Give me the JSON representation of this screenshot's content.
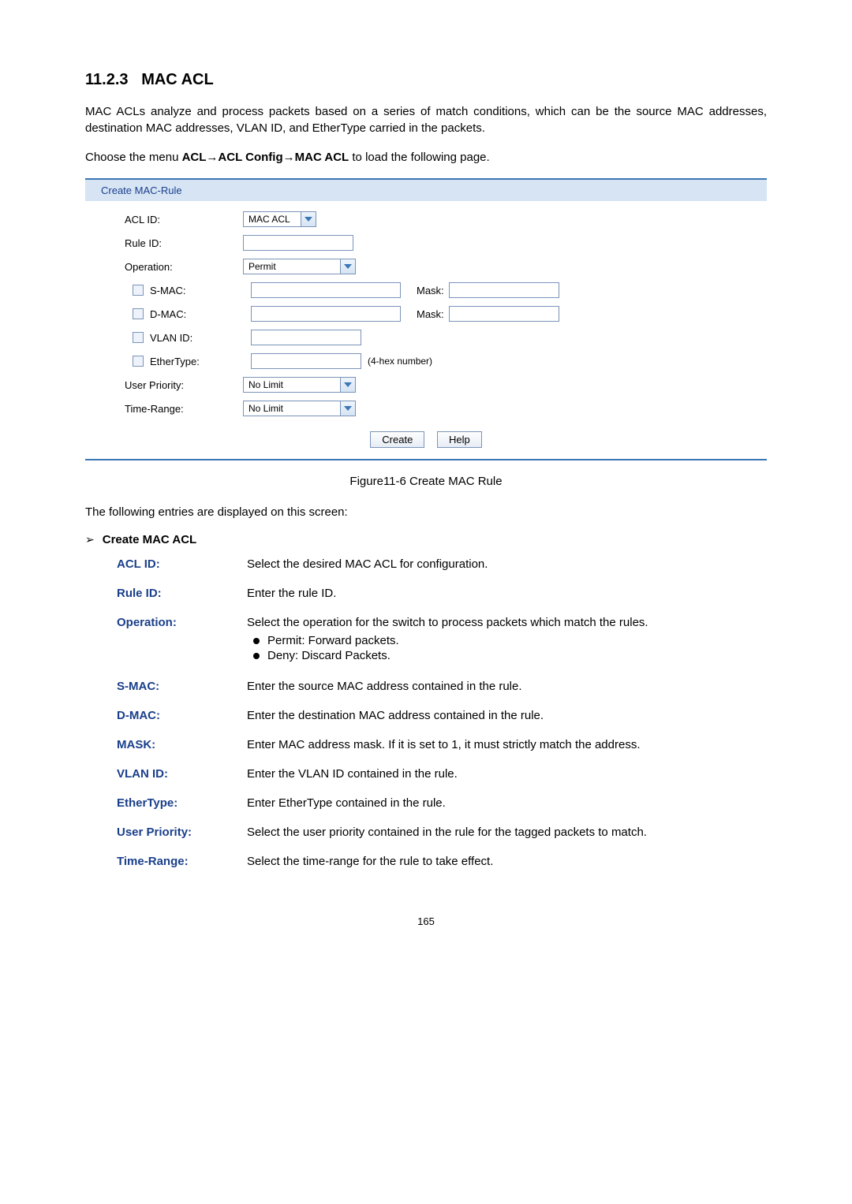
{
  "section": {
    "number": "11.2.3",
    "title": "MAC ACL",
    "intro": "MAC ACLs analyze and process packets based on a series of match conditions, which can be the source MAC addresses, destination MAC addresses, VLAN ID, and EtherType carried in the packets.",
    "menu_prefix": "Choose the menu ",
    "menu_path": "ACL→ACL Config→MAC ACL",
    "menu_suffix": " to load the following page."
  },
  "panel": {
    "header": "Create MAC-Rule",
    "labels": {
      "acl_id": "ACL ID:",
      "rule_id": "Rule ID:",
      "operation": "Operation:",
      "smac": "S-MAC:",
      "dmac": "D-MAC:",
      "vlan_id": "VLAN ID:",
      "ethertype": "EtherType:",
      "user_priority": "User Priority:",
      "time_range": "Time-Range:",
      "mask": "Mask:",
      "hex_note": "(4-hex number)"
    },
    "values": {
      "acl_id": "MAC ACL",
      "operation": "Permit",
      "user_priority": "No Limit",
      "time_range": "No Limit"
    },
    "buttons": {
      "create": "Create",
      "help": "Help"
    }
  },
  "figure_caption": "Figure11-6 Create MAC Rule",
  "screen_intro": "The following entries are displayed on this screen:",
  "def_heading": "Create MAC ACL",
  "definitions": [
    {
      "term": "ACL ID:",
      "desc": "Select the desired MAC ACL for configuration."
    },
    {
      "term": "Rule ID:",
      "desc": "Enter the rule ID."
    },
    {
      "term": "Operation:",
      "desc": "Select the operation for the switch to process packets which match the rules.",
      "bullets": [
        "Permit: Forward packets.",
        "Deny: Discard Packets."
      ]
    },
    {
      "term": "S-MAC:",
      "desc": "Enter the source MAC address contained in the rule."
    },
    {
      "term": "D-MAC:",
      "desc": "Enter the destination MAC address contained in the rule."
    },
    {
      "term": "MASK:",
      "desc": "Enter MAC address mask. If it is set to 1, it must strictly match the address."
    },
    {
      "term": "VLAN ID:",
      "desc": "Enter the VLAN ID contained in the rule."
    },
    {
      "term": "EtherType:",
      "desc": "Enter EtherType contained in the rule."
    },
    {
      "term": "User Priority:",
      "desc": "Select the user priority contained in the rule for the tagged packets to match."
    },
    {
      "term": "Time-Range:",
      "desc": "Select the time-range for the rule to take effect."
    }
  ],
  "page_number": "165"
}
